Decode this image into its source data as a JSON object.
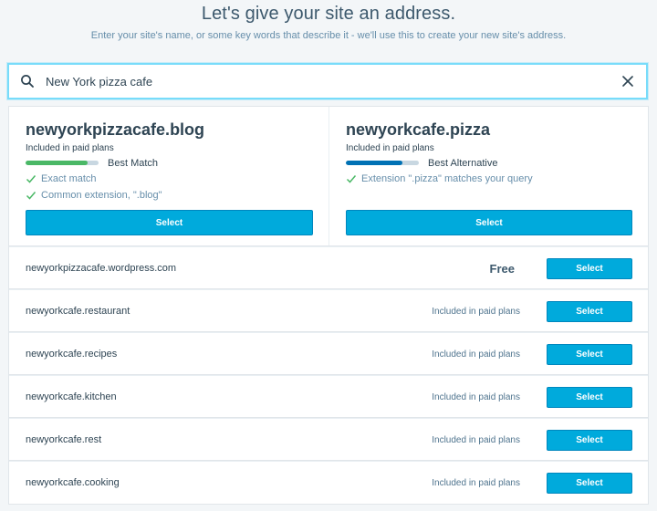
{
  "header": {
    "title": "Let's give your site an address.",
    "subtitle": "Enter your site's name, or some key words that describe it - we'll use this to create your new site's address."
  },
  "search": {
    "value": "New York pizza cafe"
  },
  "featured": [
    {
      "domain": "newyorkpizzacafe.blog",
      "plan": "Included in paid plans",
      "match_label": "Best Match",
      "match_strength": 0.85,
      "bar_color": "#4ab866",
      "reasons": [
        "Exact match",
        "Common extension, \".blog\""
      ],
      "select_label": "Select"
    },
    {
      "domain": "newyorkcafe.pizza",
      "plan": "Included in paid plans",
      "match_label": "Best Alternative",
      "match_strength": 0.78,
      "bar_color": "#0071b4",
      "reasons": [
        "Extension \".pizza\" matches your query"
      ],
      "select_label": "Select"
    }
  ],
  "suggestions": [
    {
      "domain": "newyorkpizzacafe.wordpress.com",
      "price": "Free",
      "free": true,
      "select_label": "Select"
    },
    {
      "domain": "newyorkcafe.restaurant",
      "price": "Included in paid plans",
      "free": false,
      "select_label": "Select"
    },
    {
      "domain": "newyorkcafe.recipes",
      "price": "Included in paid plans",
      "free": false,
      "select_label": "Select"
    },
    {
      "domain": "newyorkcafe.kitchen",
      "price": "Included in paid plans",
      "free": false,
      "select_label": "Select"
    },
    {
      "domain": "newyorkcafe.rest",
      "price": "Included in paid plans",
      "free": false,
      "select_label": "Select"
    },
    {
      "domain": "newyorkcafe.cooking",
      "price": "Included in paid plans",
      "free": false,
      "select_label": "Select"
    }
  ],
  "icons": {
    "search": "search-icon",
    "clear": "close-icon",
    "check": "checkmark-icon"
  },
  "colors": {
    "accent": "#00aadc",
    "check": "#4ab866",
    "focus_border": "#78dcfa"
  }
}
